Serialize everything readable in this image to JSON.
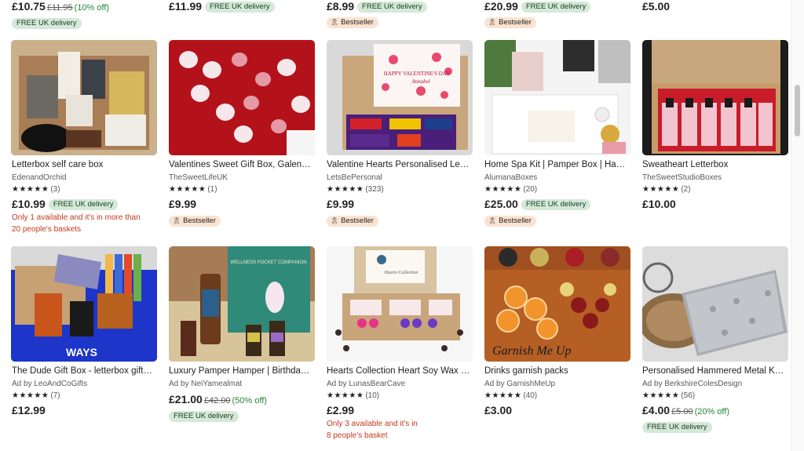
{
  "top_row": [
    {
      "price": "£10.75",
      "orig": "£11.95",
      "disc": "(10% off)",
      "free": "FREE UK delivery"
    },
    {
      "price": "£11.99",
      "free": "FREE UK delivery"
    },
    {
      "price": "£8.99",
      "free": "FREE UK delivery",
      "best": "Bestseller"
    },
    {
      "price": "£20.99",
      "free": "FREE UK delivery",
      "best": "Bestseller"
    },
    {
      "price": "£5.00"
    }
  ],
  "row1": [
    {
      "title": "Letterbox self care box",
      "shop": "EdenandOrchid",
      "stars": "★★★★★",
      "count": "(3)",
      "price": "£10.99",
      "free": "FREE UK delivery",
      "warn1": "Only 1 available and it's in more than",
      "warn2": "20 people's baskets"
    },
    {
      "title": "Valentines Sweet Gift Box, Galen…",
      "shop": "TheSweetLifeUK",
      "stars": "★★★★★",
      "count": "(1)",
      "price": "£9.99",
      "best": "Bestseller"
    },
    {
      "title": "Valentine Hearts Personalised Le…",
      "shop": "LetsBePersonal",
      "stars": "★★★★★",
      "count": "(323)",
      "price": "£9.99",
      "best": "Bestseller",
      "image_text1": "HAPPY VALENTINE'S DAY",
      "image_text2": "Annabel"
    },
    {
      "title": "Home Spa Kit | Pamper Box | Ha…",
      "shop": "AlumanaBoxes",
      "stars": "★★★★★",
      "count": "(20)",
      "price": "£25.00",
      "free": "FREE UK delivery",
      "best": "Bestseller"
    },
    {
      "title": "Sweatheart Letterbox",
      "shop": "TheSweetStudioBoxes",
      "stars": "★★★★★",
      "count": "(2)",
      "price": "£10.00"
    }
  ],
  "row2": [
    {
      "title": "The Dude Gift Box - letterbox gift…",
      "shop": "Ad by LeoAndCoGifts",
      "stars": "★★★★★",
      "count": "(7)",
      "price": "£12.99",
      "image_text": "WAYS"
    },
    {
      "title": "Luxury Pamper Hamper | Birthda…",
      "shop": "Ad by NeiYamealmat",
      "stars": "★★★★★",
      "count": "",
      "price": "£21.00",
      "orig": "£42.00",
      "disc": "(50% off)",
      "free": "FREE UK delivery",
      "image_text": "WELLNESS POCKET COMPANION"
    },
    {
      "title": "Hearts Collection Heart Soy Wax …",
      "shop": "Ad by LunasBearCave",
      "stars": "★★★★★",
      "count": "(10)",
      "price": "£2.99",
      "warn1": "Only 3 available and it's in",
      "warn2": "8 people's basket",
      "image_text": "Hearts Collection"
    },
    {
      "title": "Drinks garnish packs",
      "shop": "Ad by GarnishMeUp",
      "stars": "★★★★★",
      "count": "(40)",
      "price": "£3.00",
      "image_text": "Garnish Me Up"
    },
    {
      "title": "Personalised Hammered Metal K…",
      "shop": "Ad by BerkshireColesDesign",
      "stars": "★★★★★",
      "count": "(56)",
      "price": "£4.00",
      "orig": "£5.00",
      "disc": "(20% off)",
      "free": "FREE UK delivery"
    }
  ],
  "colors": {
    "free_badge": "#d4e9d7",
    "best_badge": "#fbe3d1",
    "warn": "#c23a1d",
    "discount": "#258635"
  }
}
